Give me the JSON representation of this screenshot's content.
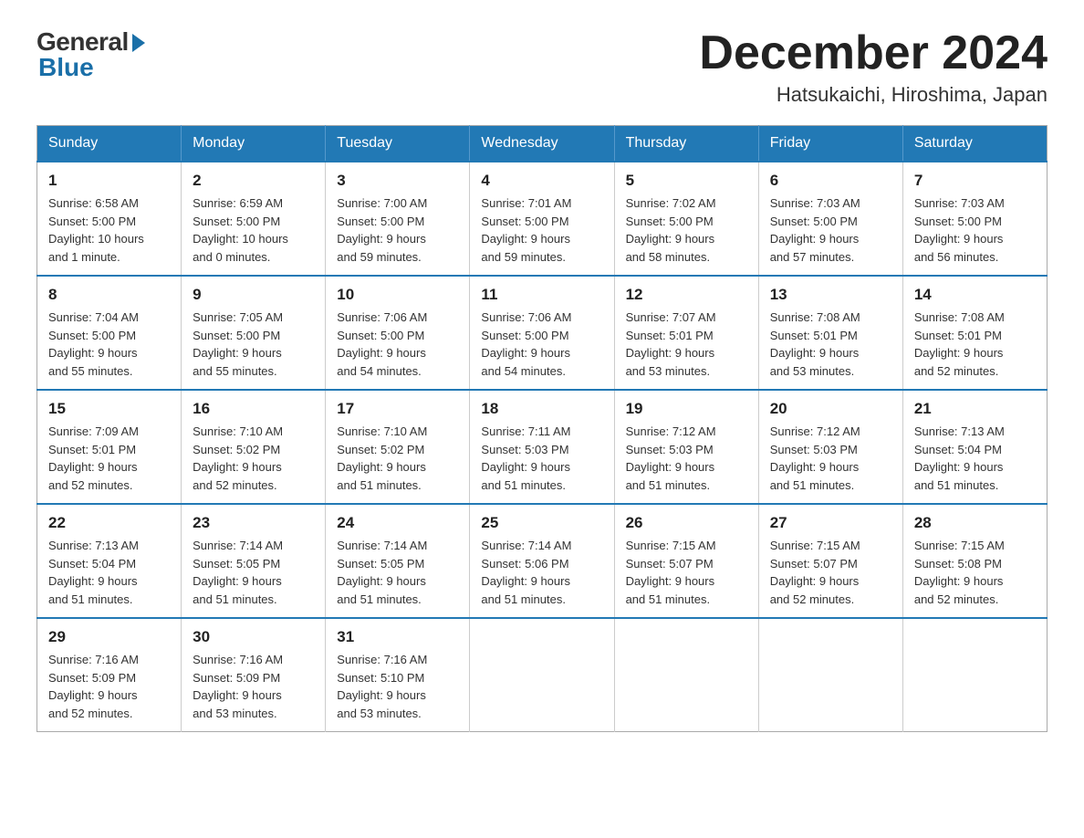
{
  "logo": {
    "general": "General",
    "blue": "Blue"
  },
  "title": {
    "month_year": "December 2024",
    "location": "Hatsukaichi, Hiroshima, Japan"
  },
  "header": {
    "days": [
      "Sunday",
      "Monday",
      "Tuesday",
      "Wednesday",
      "Thursday",
      "Friday",
      "Saturday"
    ]
  },
  "weeks": [
    [
      {
        "day": "1",
        "info": "Sunrise: 6:58 AM\nSunset: 5:00 PM\nDaylight: 10 hours\nand 1 minute."
      },
      {
        "day": "2",
        "info": "Sunrise: 6:59 AM\nSunset: 5:00 PM\nDaylight: 10 hours\nand 0 minutes."
      },
      {
        "day": "3",
        "info": "Sunrise: 7:00 AM\nSunset: 5:00 PM\nDaylight: 9 hours\nand 59 minutes."
      },
      {
        "day": "4",
        "info": "Sunrise: 7:01 AM\nSunset: 5:00 PM\nDaylight: 9 hours\nand 59 minutes."
      },
      {
        "day": "5",
        "info": "Sunrise: 7:02 AM\nSunset: 5:00 PM\nDaylight: 9 hours\nand 58 minutes."
      },
      {
        "day": "6",
        "info": "Sunrise: 7:03 AM\nSunset: 5:00 PM\nDaylight: 9 hours\nand 57 minutes."
      },
      {
        "day": "7",
        "info": "Sunrise: 7:03 AM\nSunset: 5:00 PM\nDaylight: 9 hours\nand 56 minutes."
      }
    ],
    [
      {
        "day": "8",
        "info": "Sunrise: 7:04 AM\nSunset: 5:00 PM\nDaylight: 9 hours\nand 55 minutes."
      },
      {
        "day": "9",
        "info": "Sunrise: 7:05 AM\nSunset: 5:00 PM\nDaylight: 9 hours\nand 55 minutes."
      },
      {
        "day": "10",
        "info": "Sunrise: 7:06 AM\nSunset: 5:00 PM\nDaylight: 9 hours\nand 54 minutes."
      },
      {
        "day": "11",
        "info": "Sunrise: 7:06 AM\nSunset: 5:00 PM\nDaylight: 9 hours\nand 54 minutes."
      },
      {
        "day": "12",
        "info": "Sunrise: 7:07 AM\nSunset: 5:01 PM\nDaylight: 9 hours\nand 53 minutes."
      },
      {
        "day": "13",
        "info": "Sunrise: 7:08 AM\nSunset: 5:01 PM\nDaylight: 9 hours\nand 53 minutes."
      },
      {
        "day": "14",
        "info": "Sunrise: 7:08 AM\nSunset: 5:01 PM\nDaylight: 9 hours\nand 52 minutes."
      }
    ],
    [
      {
        "day": "15",
        "info": "Sunrise: 7:09 AM\nSunset: 5:01 PM\nDaylight: 9 hours\nand 52 minutes."
      },
      {
        "day": "16",
        "info": "Sunrise: 7:10 AM\nSunset: 5:02 PM\nDaylight: 9 hours\nand 52 minutes."
      },
      {
        "day": "17",
        "info": "Sunrise: 7:10 AM\nSunset: 5:02 PM\nDaylight: 9 hours\nand 51 minutes."
      },
      {
        "day": "18",
        "info": "Sunrise: 7:11 AM\nSunset: 5:03 PM\nDaylight: 9 hours\nand 51 minutes."
      },
      {
        "day": "19",
        "info": "Sunrise: 7:12 AM\nSunset: 5:03 PM\nDaylight: 9 hours\nand 51 minutes."
      },
      {
        "day": "20",
        "info": "Sunrise: 7:12 AM\nSunset: 5:03 PM\nDaylight: 9 hours\nand 51 minutes."
      },
      {
        "day": "21",
        "info": "Sunrise: 7:13 AM\nSunset: 5:04 PM\nDaylight: 9 hours\nand 51 minutes."
      }
    ],
    [
      {
        "day": "22",
        "info": "Sunrise: 7:13 AM\nSunset: 5:04 PM\nDaylight: 9 hours\nand 51 minutes."
      },
      {
        "day": "23",
        "info": "Sunrise: 7:14 AM\nSunset: 5:05 PM\nDaylight: 9 hours\nand 51 minutes."
      },
      {
        "day": "24",
        "info": "Sunrise: 7:14 AM\nSunset: 5:05 PM\nDaylight: 9 hours\nand 51 minutes."
      },
      {
        "day": "25",
        "info": "Sunrise: 7:14 AM\nSunset: 5:06 PM\nDaylight: 9 hours\nand 51 minutes."
      },
      {
        "day": "26",
        "info": "Sunrise: 7:15 AM\nSunset: 5:07 PM\nDaylight: 9 hours\nand 51 minutes."
      },
      {
        "day": "27",
        "info": "Sunrise: 7:15 AM\nSunset: 5:07 PM\nDaylight: 9 hours\nand 52 minutes."
      },
      {
        "day": "28",
        "info": "Sunrise: 7:15 AM\nSunset: 5:08 PM\nDaylight: 9 hours\nand 52 minutes."
      }
    ],
    [
      {
        "day": "29",
        "info": "Sunrise: 7:16 AM\nSunset: 5:09 PM\nDaylight: 9 hours\nand 52 minutes."
      },
      {
        "day": "30",
        "info": "Sunrise: 7:16 AM\nSunset: 5:09 PM\nDaylight: 9 hours\nand 53 minutes."
      },
      {
        "day": "31",
        "info": "Sunrise: 7:16 AM\nSunset: 5:10 PM\nDaylight: 9 hours\nand 53 minutes."
      },
      null,
      null,
      null,
      null
    ]
  ]
}
